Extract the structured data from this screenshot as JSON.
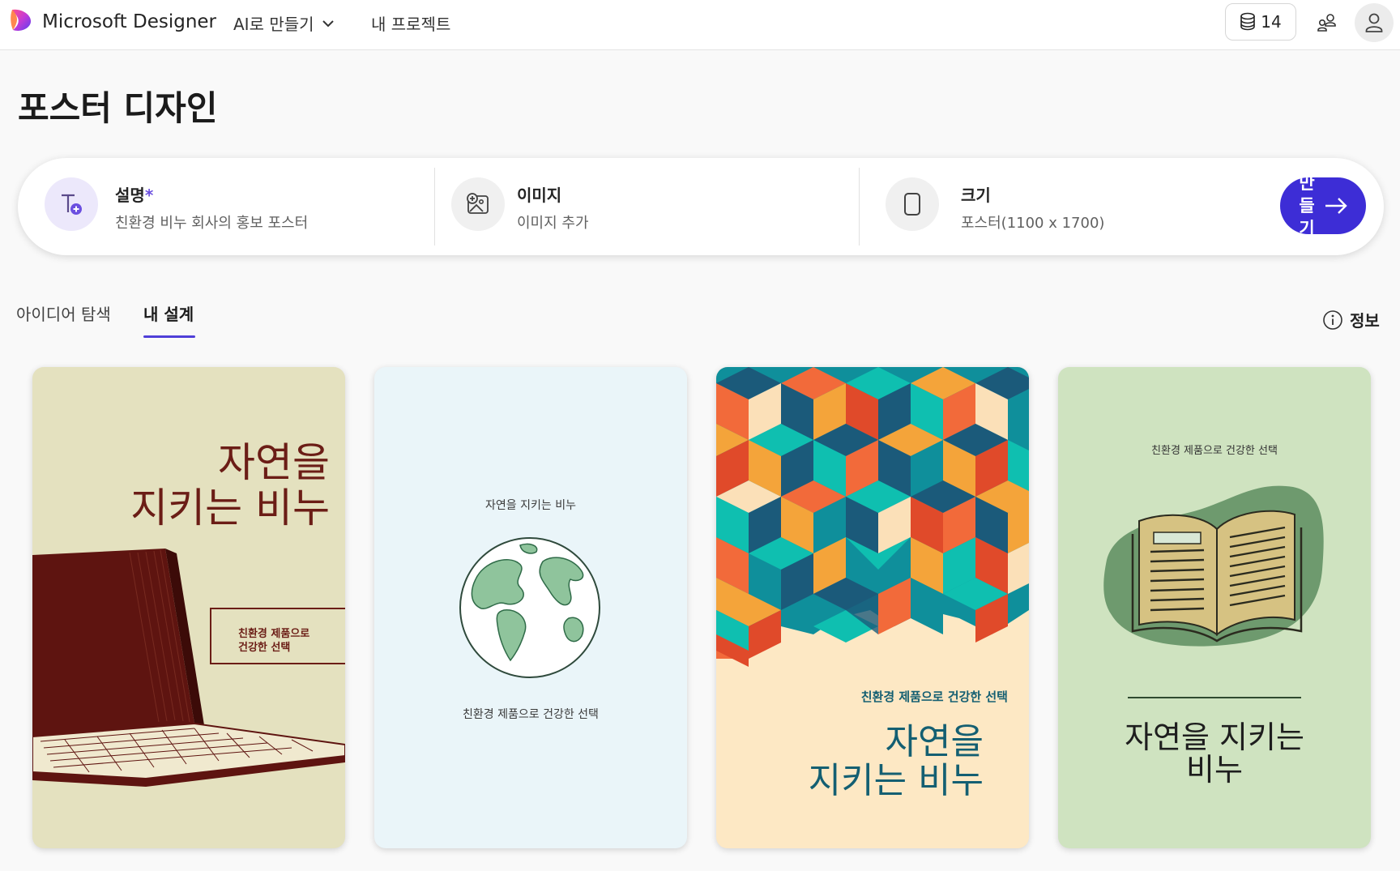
{
  "app": {
    "brand": "Microsoft Designer"
  },
  "nav": {
    "create_with_ai": "AI로 만들기",
    "my_projects": "내 프로젝트"
  },
  "header": {
    "credits": "14"
  },
  "page": {
    "title": "포스터 디자인"
  },
  "prompt": {
    "description": {
      "label": "설명",
      "required_mark": "*",
      "value": "친환경 비누 회사의 홍보 포스터"
    },
    "image": {
      "label": "이미지",
      "value": "이미지 추가"
    },
    "size": {
      "label": "크기",
      "value": "포스터(1100 x 1700)"
    },
    "create_button": "만들기"
  },
  "tabs": {
    "explore": "아이디어 탐색",
    "mine": "내 설계",
    "active": "mine"
  },
  "info_label": "정보",
  "designs": [
    {
      "headline_1": "자연을",
      "headline_2": "지키는 비누",
      "sub_1": "친환경 제품으로",
      "sub_2": "건강한 선택",
      "bg": "#e4e1bf",
      "accent": "#6b1d16"
    },
    {
      "title": "자연을 지키는 비누",
      "subtitle": "친환경 제품으로 건강한 선택",
      "bg": "#eaf5f9",
      "accent": "#2f6b48"
    },
    {
      "tagline": "친환경 제품으로 건강한 선택",
      "headline_1": "자연을",
      "headline_2": "지키는 비누",
      "bg": "#fde8c4",
      "accent": "#145f72"
    },
    {
      "tagline": "친환경 제품으로 건강한 선택",
      "headline_1": "자연을 지키는",
      "headline_2": "비누",
      "bg": "#cfe3c0",
      "accent": "#1e1e1e"
    }
  ],
  "colors": {
    "accent": "#3d2dd6",
    "tab_underline": "#4f3fd8"
  }
}
